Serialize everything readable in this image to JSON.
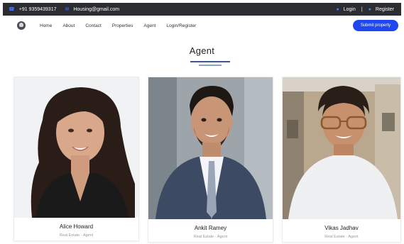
{
  "topbar": {
    "phone_icon": "phone-icon",
    "phone": "+91 9359439317",
    "email_icon": "mail-icon",
    "email": "Housing@gmail.com",
    "login_icon": "user-icon",
    "login": "Login",
    "separator": "|",
    "register_icon": "user-icon",
    "register": "Register"
  },
  "nav": {
    "logo_icon": "home-logo-icon",
    "items": [
      "Home",
      "About",
      "Contact",
      "Properties",
      "Agent",
      "Login/Register"
    ],
    "submit": "Submit property"
  },
  "section": {
    "title": "Agent"
  },
  "agents": [
    {
      "name": "Alice Howard",
      "role": "Real Estate - Agent"
    },
    {
      "name": "Ankit Ramey",
      "role": "Real Estate - Agent"
    },
    {
      "name": "Vikas Jadhav",
      "role": "Real Estate - Agent"
    }
  ],
  "colors": {
    "topbar_bg": "#2b2d31",
    "accent": "#1e47f0",
    "icon_blue": "#4d7cff"
  }
}
